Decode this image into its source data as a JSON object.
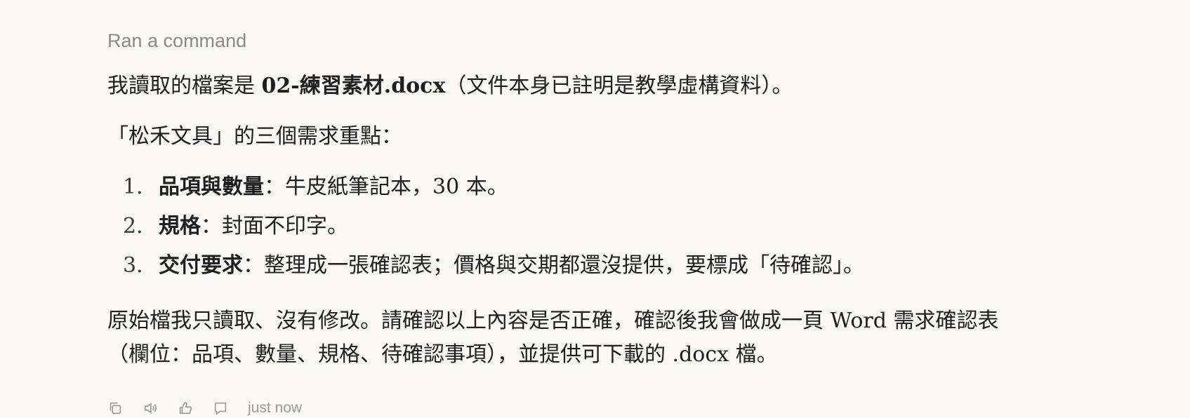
{
  "status": {
    "ran_command": "Ran a command"
  },
  "intro": {
    "prefix": "我讀取的檔案是 ",
    "filename": "02-練習素材.docx",
    "suffix": "（文件本身已註明是教學虛構資料）。"
  },
  "summary_heading": "「松禾文具」的三個需求重點：",
  "requirements": [
    {
      "number": "1.",
      "label": "品項與數量",
      "text": "：牛皮紙筆記本，30 本。"
    },
    {
      "number": "2.",
      "label": "規格",
      "text": "：封面不印字。"
    },
    {
      "number": "3.",
      "label": "交付要求",
      "text": "：整理成一張確認表；價格與交期都還沒提供，要標成「待確認」。"
    }
  ],
  "closing": {
    "line1": "原始檔我只讀取、沒有修改。請確認以上內容是否正確，確認後我會做成一頁 Word 需求確認表",
    "line2": "（欄位：品項、數量、規格、待確認事項），並提供可下載的 .docx 檔。"
  },
  "actions": {
    "icons": [
      "copy-icon",
      "speaker-icon",
      "thumbs-up-icon",
      "comment-icon"
    ],
    "timestamp": "just now"
  }
}
